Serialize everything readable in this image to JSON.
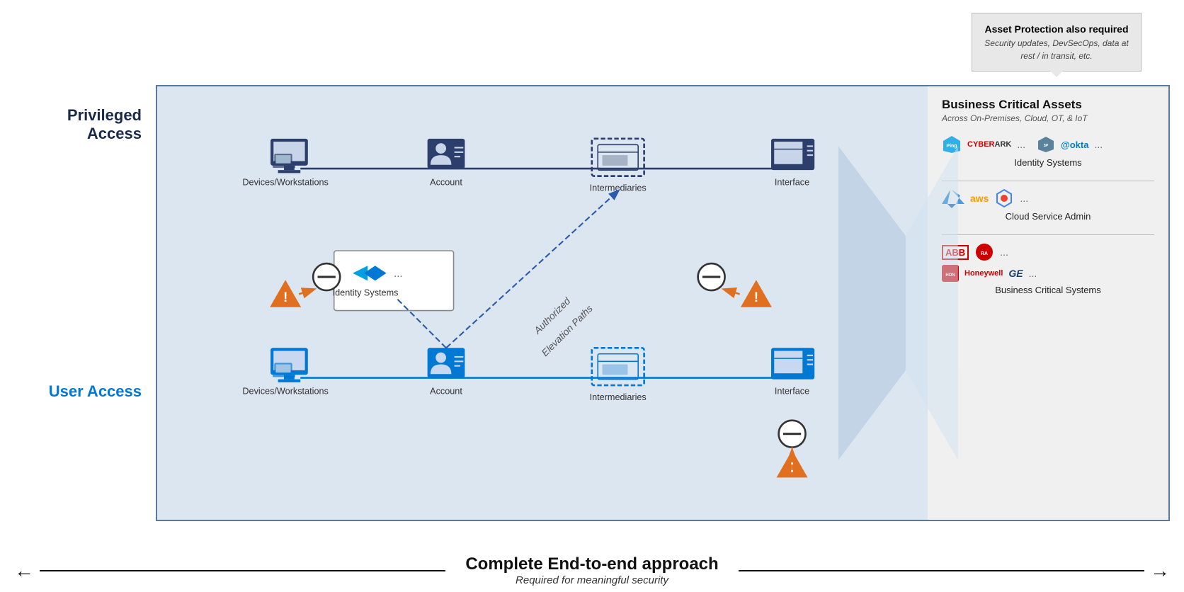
{
  "callout": {
    "title": "Asset Protection also required",
    "subtitle": "Security updates, DevSecOps, data at rest / in transit, etc."
  },
  "rightPanel": {
    "title": "Business Critical Assets",
    "subtitle": "Across On-Premises, Cloud, OT, & IoT",
    "sections": [
      {
        "label": "Identity Systems",
        "vendors": [
          "Ping",
          "CYBERARK",
          "SailPoint",
          "okta",
          "..."
        ]
      },
      {
        "label": "Cloud Service Admin",
        "vendors": [
          "Azure",
          "aws",
          "GCP",
          "..."
        ]
      },
      {
        "label": "Business Critical Systems",
        "vendors": [
          "ABB",
          "Rockwell Automation",
          "Honeywell",
          "GE",
          "..."
        ]
      }
    ]
  },
  "privilegedAccess": {
    "label": "Privileged Access",
    "nodes": [
      {
        "id": "priv-devices",
        "label": "Devices/Workstations"
      },
      {
        "id": "priv-account",
        "label": "Account"
      },
      {
        "id": "priv-intermediaries",
        "label": "Intermediaries"
      },
      {
        "id": "priv-interface",
        "label": "Interface"
      }
    ]
  },
  "userAccess": {
    "label": "User Access",
    "nodes": [
      {
        "id": "user-devices",
        "label": "Devices/Workstations"
      },
      {
        "id": "user-account",
        "label": "Account"
      },
      {
        "id": "user-intermediaries",
        "label": "Intermediaries"
      },
      {
        "id": "user-interface",
        "label": "Interface"
      }
    ]
  },
  "identitySystems": {
    "label": "Identity Systems"
  },
  "elevationPath": {
    "label1": "Authorized",
    "label2": "Elevation Paths"
  },
  "bottom": {
    "title": "Complete End-to-end approach",
    "subtitle": "Required for meaningful security",
    "arrowLeft": "←",
    "arrowRight": "→"
  }
}
